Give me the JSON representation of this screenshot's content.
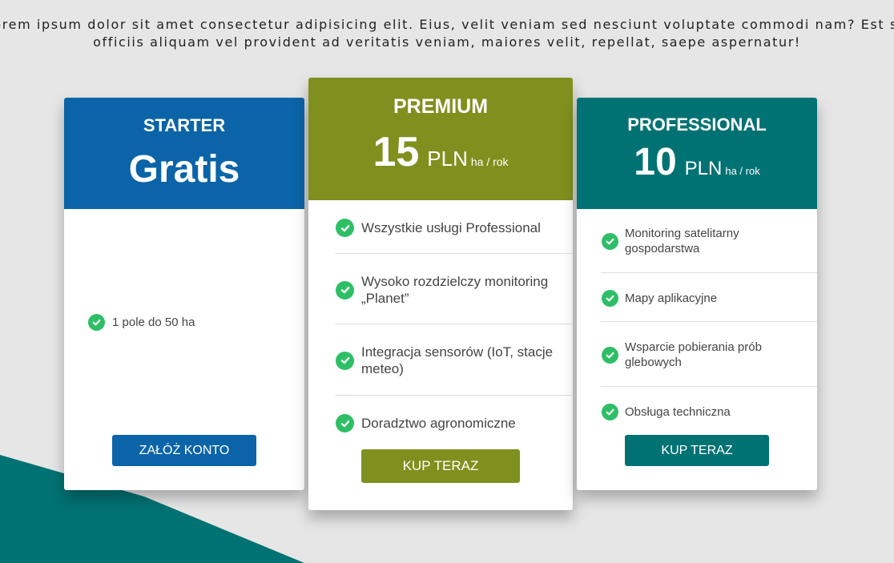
{
  "intro_text": "Lorem ipsum dolor sit amet consectetur adipisicing elit. Eius, velit veniam sed nesciunt voluptate commodi nam? Est sit officiis aliquam vel provident ad veritatis veniam, maiores velit, repellat, saepe aspernatur!",
  "colors": {
    "starter": "#0b64a7",
    "premium": "#80901e",
    "professional": "#017273",
    "check": "#2ebf66",
    "background": "#e6e6e6"
  },
  "plans": {
    "starter": {
      "name": "STARTER",
      "price": "Gratis",
      "features": [
        "1 pole do 50 ha"
      ],
      "button": "ZAŁÓŻ KONTO"
    },
    "premium": {
      "name": "PREMIUM",
      "price": "15",
      "currency": "PLN",
      "unit": "ha / rok",
      "features": [
        "Wszystkie usługi Professional",
        "Wysoko rozdzielczy monitoring „Planet”",
        "Integracja sensorów (IoT, stacje meteo)",
        "Doradztwo agronomiczne"
      ],
      "button": "KUP TERAZ"
    },
    "professional": {
      "name": "PROFESSIONAL",
      "price": "10",
      "currency": "PLN",
      "unit": "ha / rok",
      "features": [
        "Monitoring satelitarny gospodarstwa",
        "Mapy aplikacyjne",
        "Wsparcie pobierania prób glebowych",
        "Obsługa techniczna"
      ],
      "button": "KUP TERAZ"
    }
  }
}
